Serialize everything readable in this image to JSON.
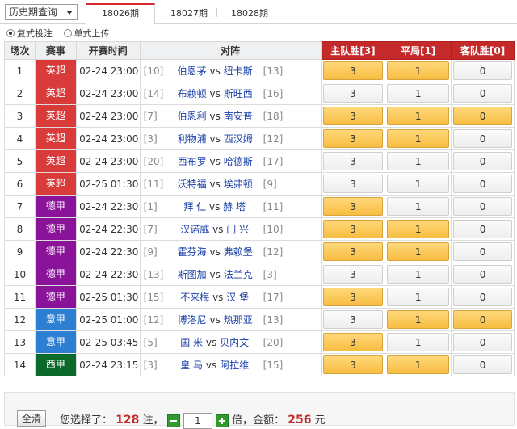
{
  "header": {
    "history_select": "历史期查询",
    "tabs": [
      {
        "label": "18026期",
        "active": true
      },
      {
        "label": "18027期",
        "active": false
      },
      {
        "label": "18028期",
        "active": false
      }
    ],
    "separator": "|"
  },
  "mode": {
    "options": [
      {
        "label": "复式投注",
        "selected": true
      },
      {
        "label": "单式上传",
        "selected": false
      }
    ]
  },
  "table": {
    "headers": {
      "no": "场次",
      "league": "赛事",
      "time": "开赛时间",
      "match": "对阵",
      "home": "主队胜[3]",
      "draw": "平局[1]",
      "away": "客队胜[0]"
    },
    "option_values": {
      "home": "3",
      "draw": "1",
      "away": "0"
    },
    "rows": [
      {
        "no": "1",
        "league": "英超",
        "league_color": "#d93a3a",
        "time": "02-24 23:00",
        "rank_home": "[10]",
        "home": "伯恩茅",
        "vs": "vs",
        "away": "纽卡斯",
        "rank_away": "[13]",
        "sel": [
          true,
          true,
          false
        ]
      },
      {
        "no": "2",
        "league": "英超",
        "league_color": "#d93a3a",
        "time": "02-24 23:00",
        "rank_home": "[14]",
        "home": "布赖顿",
        "vs": "vs",
        "away": "斯旺西",
        "rank_away": "[16]",
        "sel": [
          false,
          false,
          false
        ]
      },
      {
        "no": "3",
        "league": "英超",
        "league_color": "#d93a3a",
        "time": "02-24 23:00",
        "rank_home": "[7]",
        "home": "伯恩利",
        "vs": "vs",
        "away": "南安普",
        "rank_away": "[18]",
        "sel": [
          true,
          true,
          true
        ]
      },
      {
        "no": "4",
        "league": "英超",
        "league_color": "#d93a3a",
        "time": "02-24 23:00",
        "rank_home": "[3]",
        "home": "利物浦",
        "vs": "vs",
        "away": "西汉姆",
        "rank_away": "[12]",
        "sel": [
          true,
          true,
          false
        ]
      },
      {
        "no": "5",
        "league": "英超",
        "league_color": "#d93a3a",
        "time": "02-24 23:00",
        "rank_home": "[20]",
        "home": "西布罗",
        "vs": "vs",
        "away": "哈德斯",
        "rank_away": "[17]",
        "sel": [
          false,
          false,
          false
        ]
      },
      {
        "no": "6",
        "league": "英超",
        "league_color": "#d93a3a",
        "time": "02-25 01:30",
        "rank_home": "[11]",
        "home": "沃特福",
        "vs": "vs",
        "away": "埃弗顿",
        "rank_away": "[9]",
        "sel": [
          false,
          false,
          false
        ]
      },
      {
        "no": "7",
        "league": "德甲",
        "league_color": "#8a139a",
        "time": "02-24 22:30",
        "rank_home": "[1]",
        "home": "拜 仁",
        "vs": "vs",
        "away": "赫 塔",
        "rank_away": "[11]",
        "sel": [
          true,
          false,
          false
        ]
      },
      {
        "no": "8",
        "league": "德甲",
        "league_color": "#8a139a",
        "time": "02-24 22:30",
        "rank_home": "[7]",
        "home": "汉诺威",
        "vs": "vs",
        "away": "门 兴",
        "rank_away": "[10]",
        "sel": [
          true,
          true,
          false
        ]
      },
      {
        "no": "9",
        "league": "德甲",
        "league_color": "#8a139a",
        "time": "02-24 22:30",
        "rank_home": "[9]",
        "home": "霍芬海",
        "vs": "vs",
        "away": "弗赖堡",
        "rank_away": "[12]",
        "sel": [
          true,
          true,
          false
        ]
      },
      {
        "no": "10",
        "league": "德甲",
        "league_color": "#8a139a",
        "time": "02-24 22:30",
        "rank_home": "[13]",
        "home": "斯图加",
        "vs": "vs",
        "away": "法兰克",
        "rank_away": "[3]",
        "sel": [
          false,
          false,
          false
        ]
      },
      {
        "no": "11",
        "league": "德甲",
        "league_color": "#8a139a",
        "time": "02-25 01:30",
        "rank_home": "[15]",
        "home": "不来梅",
        "vs": "vs",
        "away": "汉 堡",
        "rank_away": "[17]",
        "sel": [
          true,
          false,
          false
        ]
      },
      {
        "no": "12",
        "league": "意甲",
        "league_color": "#2d7fd3",
        "time": "02-25 01:00",
        "rank_home": "[12]",
        "home": "博洛尼",
        "vs": "vs",
        "away": "热那亚",
        "rank_away": "[13]",
        "sel": [
          false,
          true,
          true
        ]
      },
      {
        "no": "13",
        "league": "意甲",
        "league_color": "#2d7fd3",
        "time": "02-25 03:45",
        "rank_home": "[5]",
        "home": "国 米",
        "vs": "vs",
        "away": "贝内文",
        "rank_away": "[20]",
        "sel": [
          true,
          false,
          false
        ]
      },
      {
        "no": "14",
        "league": "西甲",
        "league_color": "#0a6a2a",
        "time": "02-24 23:15",
        "rank_home": "[3]",
        "home": "皇 马",
        "vs": "vs",
        "away": "阿拉维",
        "rank_away": "[15]",
        "sel": [
          true,
          true,
          false
        ]
      }
    ]
  },
  "footer": {
    "clear_label": "全清",
    "text_selected": "您选择了：",
    "notes": "128",
    "text_notes": "注，",
    "multiplier": "1",
    "text_times": "倍，金额：",
    "amount": "256",
    "text_yuan": "元"
  }
}
